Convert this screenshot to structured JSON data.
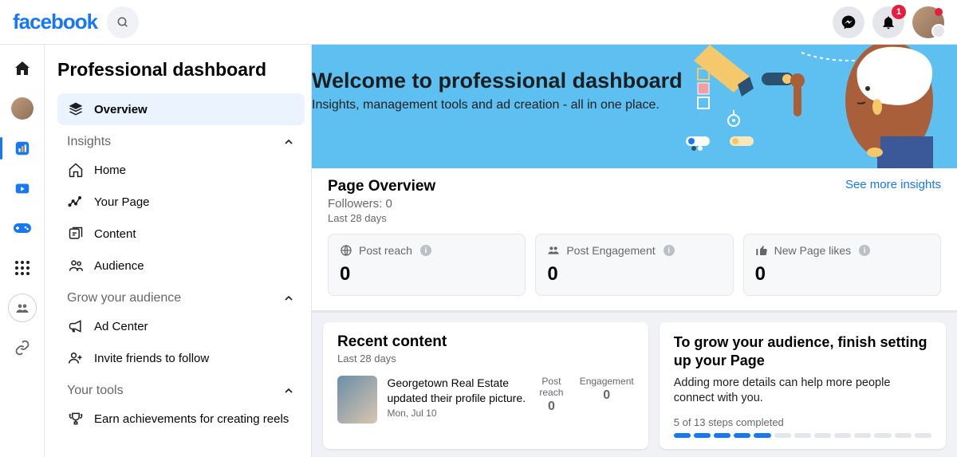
{
  "header": {
    "logo": "facebook",
    "notif_count": "1"
  },
  "sidebar": {
    "title": "Professional dashboard",
    "overview": "Overview",
    "section_insights": "Insights",
    "insights": {
      "home": "Home",
      "page": "Your Page",
      "content": "Content",
      "audience": "Audience"
    },
    "section_grow": "Grow your audience",
    "grow": {
      "adcenter": "Ad Center",
      "invite": "Invite friends to follow"
    },
    "section_tools": "Your tools",
    "tools": {
      "achievements": "Earn achievements for creating reels"
    }
  },
  "hero": {
    "title": "Welcome to professional dashboard",
    "subtitle": "Insights, management tools and ad creation - all in one place."
  },
  "overview": {
    "title": "Page Overview",
    "followers_label": "Followers: 0",
    "period": "Last 28 days",
    "see_more": "See more insights",
    "stats": [
      {
        "label": "Post reach",
        "value": "0"
      },
      {
        "label": "Post Engagement",
        "value": "0"
      },
      {
        "label": "New Page likes",
        "value": "0"
      }
    ]
  },
  "recent": {
    "title": "Recent content",
    "period": "Last 28 days",
    "item_text": "Georgetown Real Estate updated their profile picture.",
    "item_date": "Mon, Jul 10",
    "reach_label": "Post reach",
    "reach_value": "0",
    "eng_label": "Engagement",
    "eng_value": "0"
  },
  "grow": {
    "title": "To grow your audience, finish setting up your Page",
    "subtitle": "Adding more details can help more people connect with you.",
    "progress": "5 of 13 steps completed",
    "completed": 5,
    "total": 13
  }
}
